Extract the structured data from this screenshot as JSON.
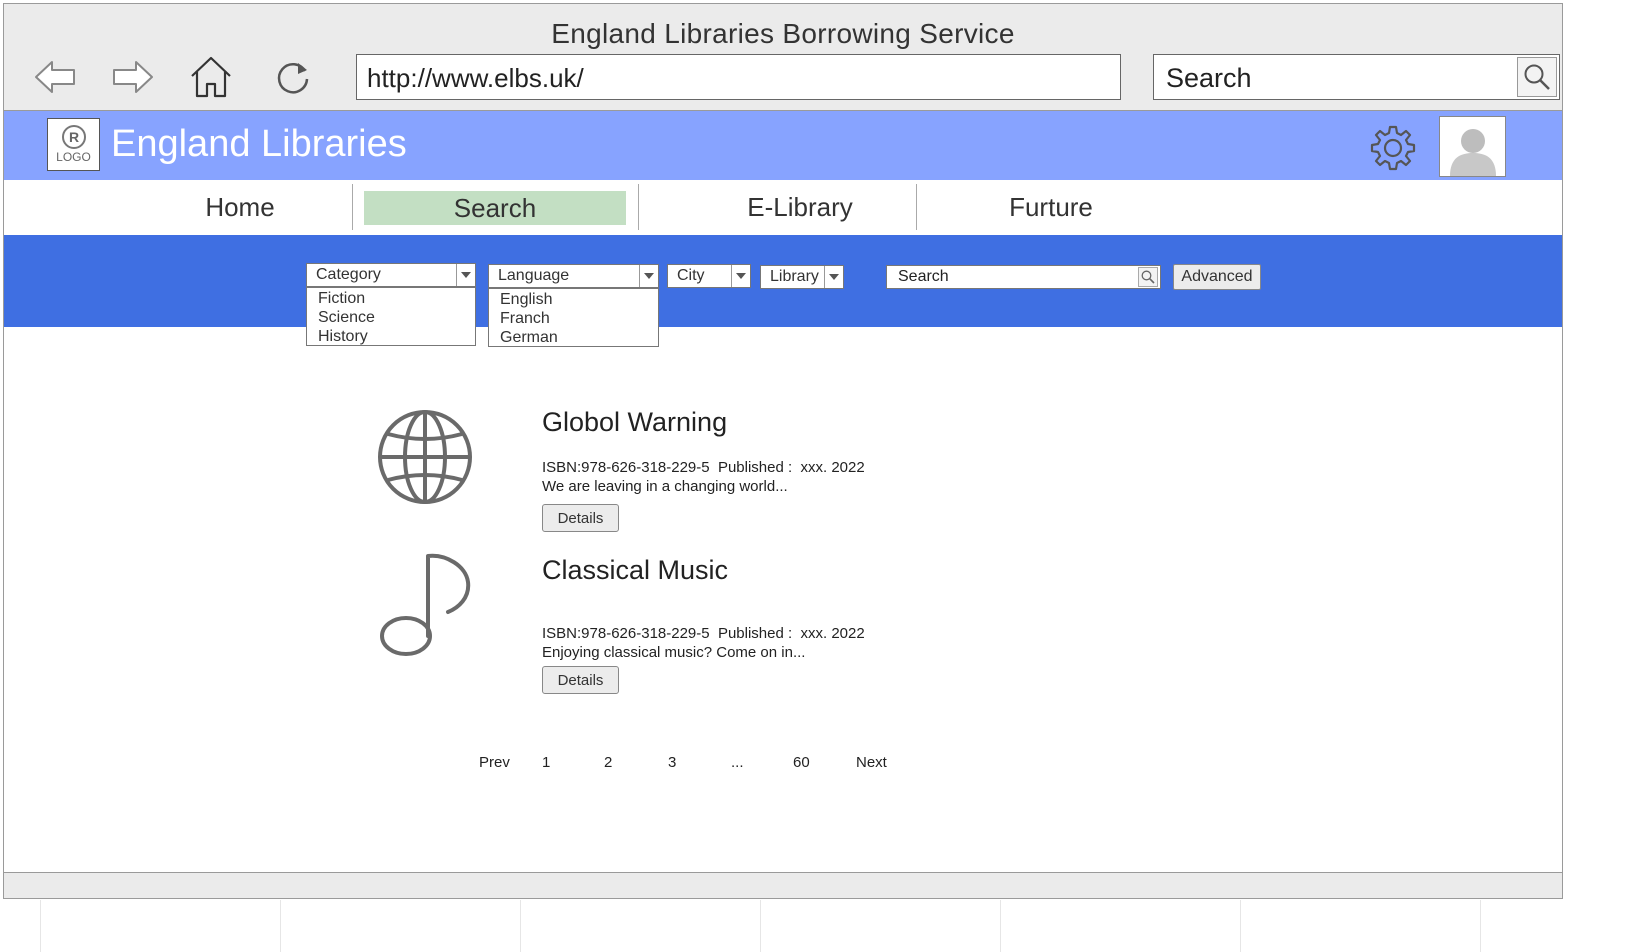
{
  "window": {
    "title": "England Libraries Borrowing Service"
  },
  "browser": {
    "url": "http://www.elbs.uk/",
    "search_placeholder": "Search",
    "icons": [
      "back-arrow-icon",
      "forward-arrow-icon",
      "home-icon",
      "refresh-icon",
      "search-icon"
    ]
  },
  "header": {
    "logo_text": "LOGO",
    "logo_mark": "R",
    "site_title": "England Libraries"
  },
  "nav": {
    "tabs": [
      {
        "label": "Home",
        "active": false
      },
      {
        "label": "Search",
        "active": true
      },
      {
        "label": "E-Library",
        "active": false
      },
      {
        "label": "Furture",
        "active": false
      }
    ]
  },
  "filters": {
    "category": {
      "label": "Category",
      "options": [
        "Fiction",
        "Science",
        "History"
      ]
    },
    "language": {
      "label": "Language",
      "options": [
        "English",
        "Franch",
        "German"
      ]
    },
    "city": {
      "label": "City"
    },
    "library": {
      "label": "Library"
    },
    "search_placeholder": "Search",
    "advanced_label": "Advanced"
  },
  "results": [
    {
      "icon": "globe-icon",
      "title": "Globol Warning",
      "meta": "ISBN:978-626-318-229-5  Published :  xxx. 2022",
      "summary": "We are leaving in a changing world...",
      "details_label": "Details"
    },
    {
      "icon": "music-note-icon",
      "title": "Classical Music",
      "meta": "ISBN:978-626-318-229-5  Published :  xxx. 2022",
      "summary": "Enjoying classical music? Come on in...",
      "details_label": "Details"
    }
  ],
  "pagination": {
    "prev": "Prev",
    "pages": [
      "1",
      "2",
      "3",
      "...",
      "60"
    ],
    "next": "Next"
  },
  "colors": {
    "header_bg": "#87a3ff",
    "filter_bar_bg": "#3f6fe2",
    "active_tab_bg": "#c3dfc3",
    "chrome_bg": "#ebebeb"
  }
}
